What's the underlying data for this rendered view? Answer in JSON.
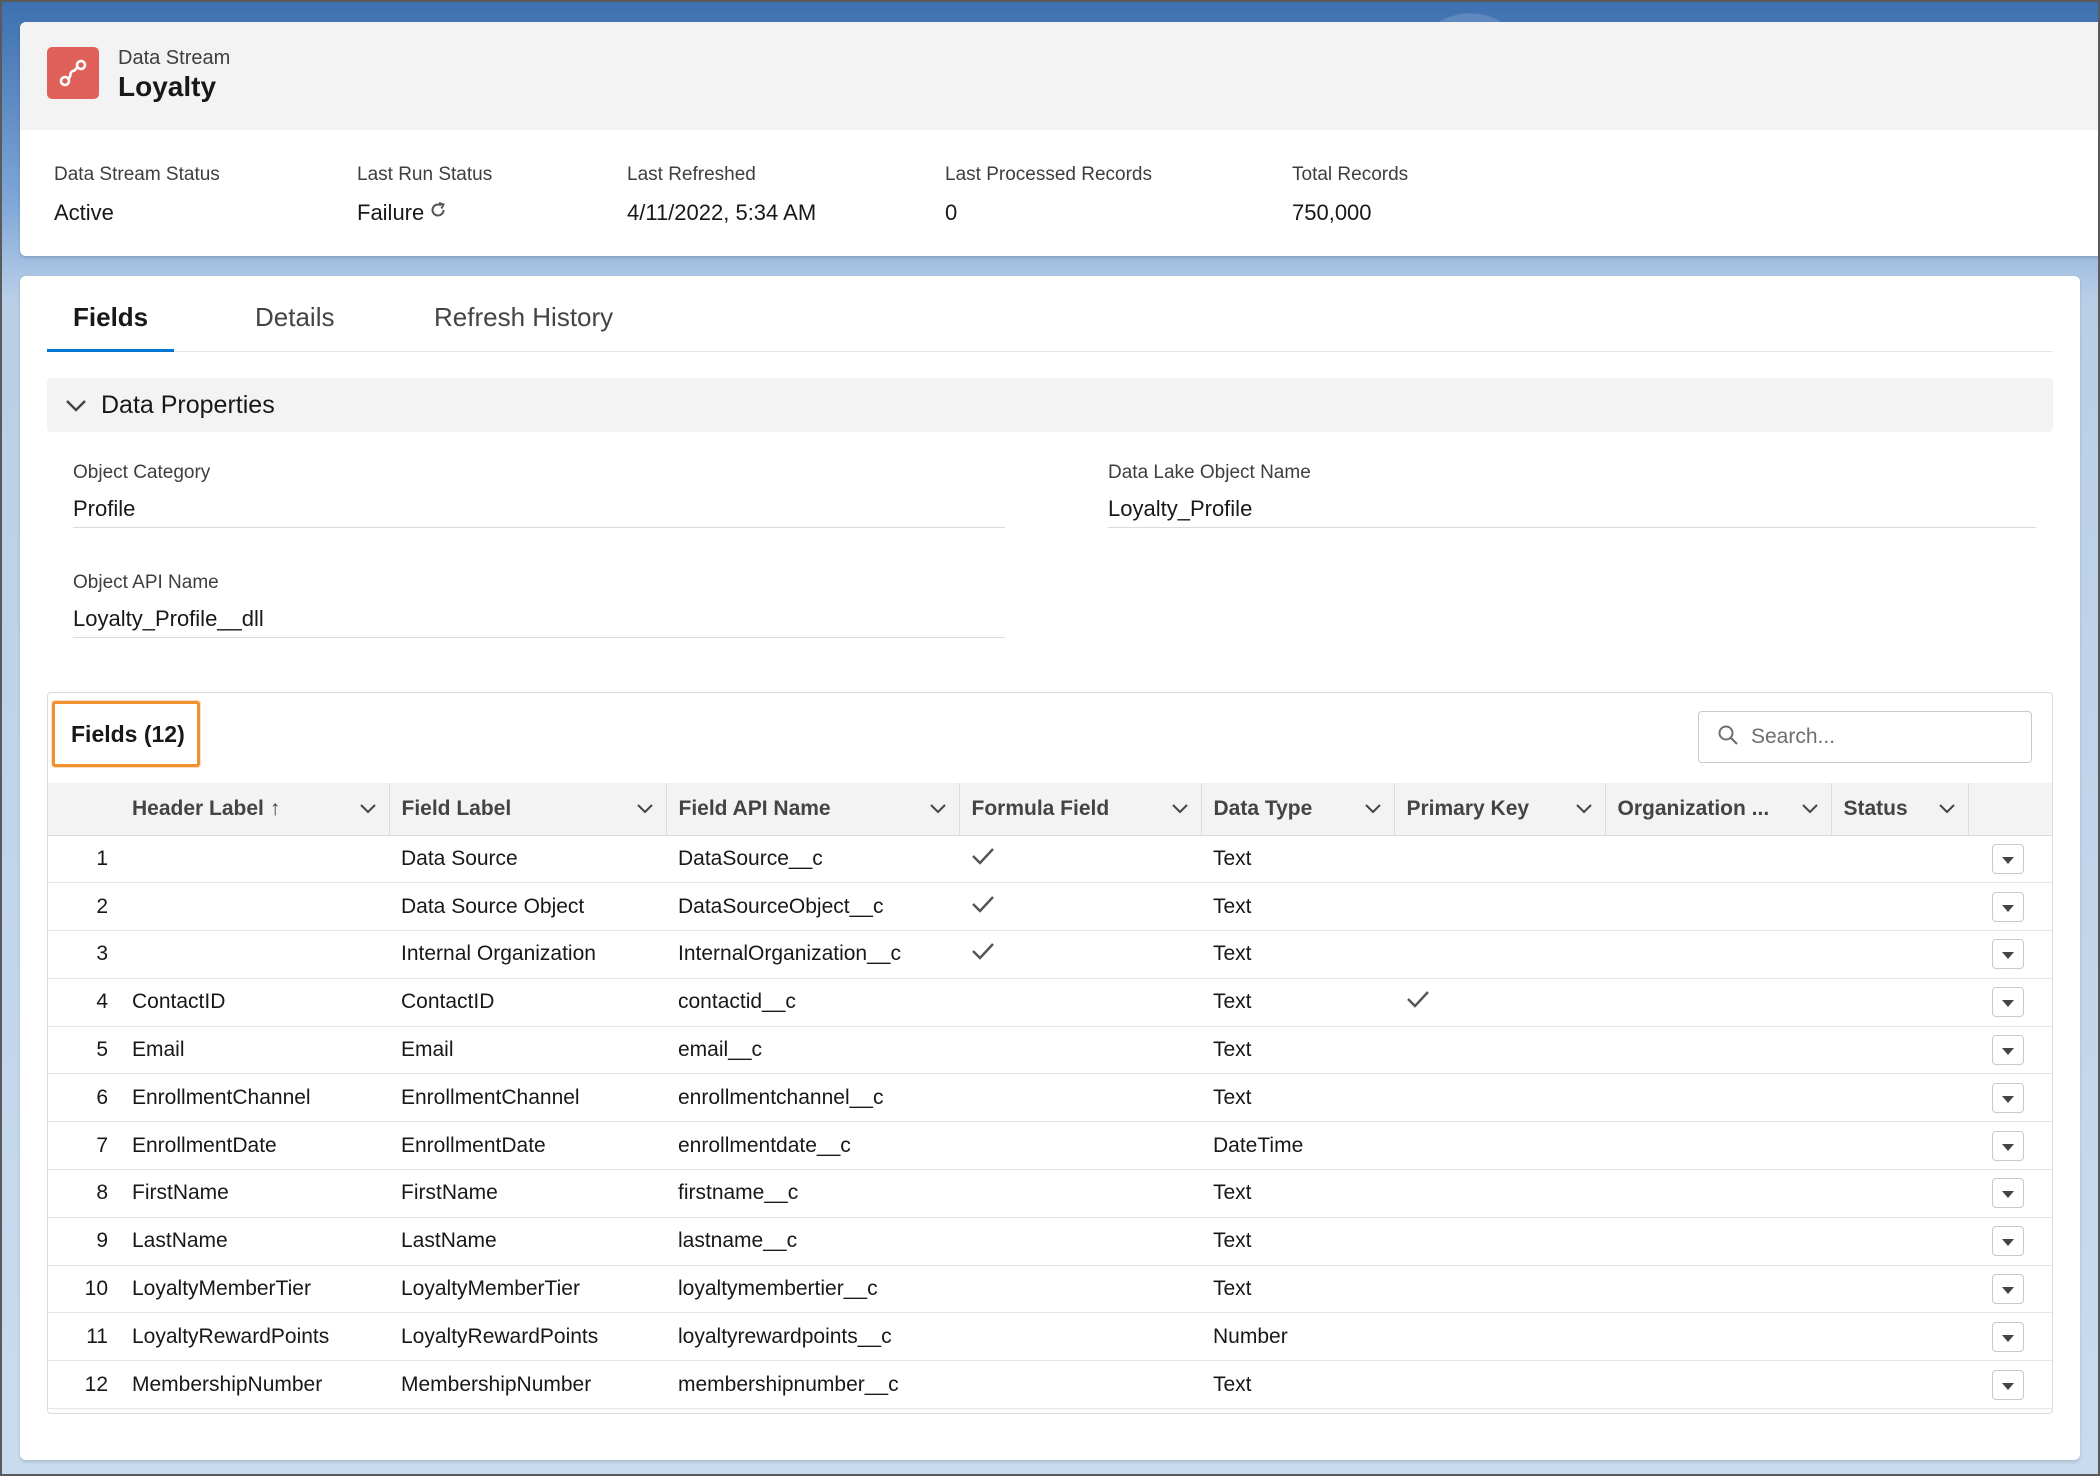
{
  "header": {
    "object_type": "Data Stream",
    "title": "Loyalty",
    "icon": "data-stream-icon",
    "icon_color": "#e0605a"
  },
  "highlights": [
    {
      "label": "Data Stream Status",
      "value": "Active"
    },
    {
      "label": "Last Run Status",
      "value": "Failure",
      "icon": "refresh-icon"
    },
    {
      "label": "Last Refreshed",
      "value": "4/11/2022, 5:34 AM"
    },
    {
      "label": "Last Processed Records",
      "value": "0"
    },
    {
      "label": "Total Records",
      "value": "750,000"
    }
  ],
  "tabs": [
    {
      "label": "Fields",
      "active": true
    },
    {
      "label": "Details",
      "active": false
    },
    {
      "label": "Refresh History",
      "active": false
    }
  ],
  "data_properties": {
    "section_title": "Data Properties",
    "object_category_label": "Object Category",
    "object_category_value": "Profile",
    "dlo_name_label": "Data Lake Object Name",
    "dlo_name_value": "Loyalty_Profile",
    "api_name_label": "Object API Name",
    "api_name_value": "Loyalty_Profile__dll"
  },
  "fields": {
    "title": "Fields (12)",
    "search_placeholder": "Search...",
    "columns": [
      "Header Label",
      "Field Label",
      "Field API Name",
      "Formula Field",
      "Data Type",
      "Primary Key",
      "Organization ...",
      "Status"
    ],
    "sort_indicator": "↑",
    "rows": [
      {
        "n": "1",
        "header": "",
        "label": "Data Source",
        "api": "DataSource__c",
        "formula": true,
        "type": "Text",
        "pk": false
      },
      {
        "n": "2",
        "header": "",
        "label": "Data Source Object",
        "api": "DataSourceObject__c",
        "formula": true,
        "type": "Text",
        "pk": false
      },
      {
        "n": "3",
        "header": "",
        "label": "Internal Organization",
        "api": "InternalOrganization__c",
        "formula": true,
        "type": "Text",
        "pk": false
      },
      {
        "n": "4",
        "header": "ContactID",
        "label": "ContactID",
        "api": "contactid__c",
        "formula": false,
        "type": "Text",
        "pk": true
      },
      {
        "n": "5",
        "header": "Email",
        "label": "Email",
        "api": "email__c",
        "formula": false,
        "type": "Text",
        "pk": false
      },
      {
        "n": "6",
        "header": "EnrollmentChannel",
        "label": "EnrollmentChannel",
        "api": "enrollmentchannel__c",
        "formula": false,
        "type": "Text",
        "pk": false
      },
      {
        "n": "7",
        "header": "EnrollmentDate",
        "label": "EnrollmentDate",
        "api": "enrollmentdate__c",
        "formula": false,
        "type": "DateTime",
        "pk": false
      },
      {
        "n": "8",
        "header": "FirstName",
        "label": "FirstName",
        "api": "firstname__c",
        "formula": false,
        "type": "Text",
        "pk": false
      },
      {
        "n": "9",
        "header": "LastName",
        "label": "LastName",
        "api": "lastname__c",
        "formula": false,
        "type": "Text",
        "pk": false
      },
      {
        "n": "10",
        "header": "LoyaltyMemberTier",
        "label": "LoyaltyMemberTier",
        "api": "loyaltymembertier__c",
        "formula": false,
        "type": "Text",
        "pk": false
      },
      {
        "n": "11",
        "header": "LoyaltyRewardPoints",
        "label": "LoyaltyRewardPoints",
        "api": "loyaltyrewardpoints__c",
        "formula": false,
        "type": "Number",
        "pk": false
      },
      {
        "n": "12",
        "header": "MembershipNumber",
        "label": "MembershipNumber",
        "api": "membershipnumber__c",
        "formula": false,
        "type": "Text",
        "pk": false
      }
    ]
  }
}
